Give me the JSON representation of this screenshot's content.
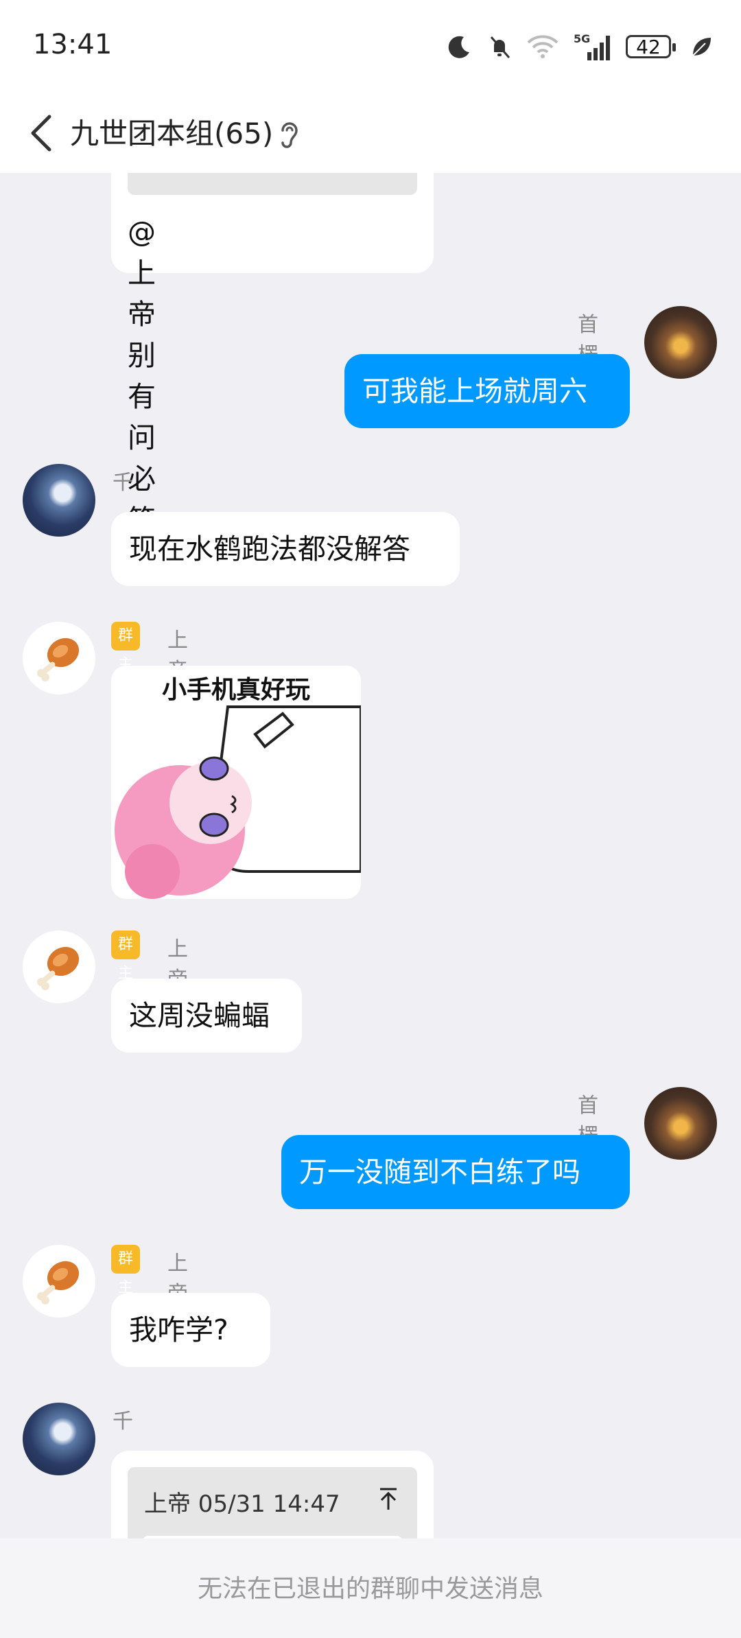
{
  "status_bar": {
    "time": "13:41",
    "battery": "42",
    "network_label": "5G",
    "icons": [
      "moon-icon",
      "bell-muted-icon",
      "wifi-icon",
      "signal-icon",
      "battery-icon",
      "leaf-icon"
    ]
  },
  "header": {
    "title": "九世团本组(65)",
    "icons": [
      "back-arrow-icon",
      "ear-icon"
    ]
  },
  "messages": [
    {
      "type": "text",
      "side": "left",
      "text": "@上帝 别有问必答了"
    },
    {
      "type": "text",
      "side": "right",
      "sender": "首楞",
      "text": "可我能上场就周六"
    },
    {
      "type": "text",
      "side": "left",
      "sender": "千",
      "text": "现在水鹤跑法都没解答"
    },
    {
      "type": "sticker",
      "side": "left",
      "sender": "上帝",
      "badge": "群主",
      "caption": "小手机真好玩"
    },
    {
      "type": "text",
      "side": "left",
      "sender": "上帝",
      "badge": "群主",
      "text": "这周没蝙蝠"
    },
    {
      "type": "text",
      "side": "right",
      "sender": "首楞",
      "text": "万一没随到不白练了吗"
    },
    {
      "type": "text",
      "side": "left",
      "sender": "上帝",
      "badge": "群主",
      "text": "我咋学?"
    },
    {
      "type": "reply",
      "side": "left",
      "sender": "千",
      "quote": "上帝 05/31 14:47"
    }
  ],
  "bottom_bar": {
    "text": "无法在已退出的群聊中发送消息"
  },
  "colors": {
    "outgoing_bubble": "#0099ff",
    "badge": "#f7b927",
    "background": "#efeff4"
  }
}
